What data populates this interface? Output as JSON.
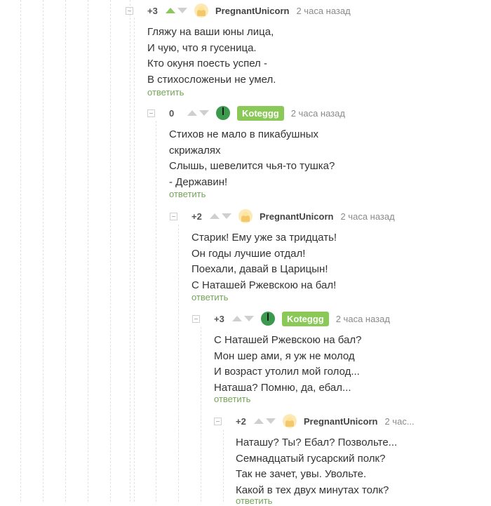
{
  "comments": [
    {
      "rating": "+3",
      "upvoted": true,
      "author": "PregnantUnicorn",
      "avatar": "unicorn-avatar",
      "time": "2 часа назад",
      "lines": [
        "Гляжу на ваши юны лица,",
        "И чую, что я гусеница.",
        "Кто окуня поесть успел -",
        "В стихосложеньи не умел."
      ],
      "reply": "ответить"
    },
    {
      "rating": "0",
      "upvoted": false,
      "author": "Koteggg",
      "avatar": "green-avatar",
      "time": "2 часа назад",
      "lines": [
        "Стихов не мало в пикабушных",
        "скрижалях",
        "Слышь, шевелится чья-то тушка?",
        "- Державин!"
      ],
      "reply": "ответить"
    },
    {
      "rating": "+2",
      "upvoted": false,
      "author": "PregnantUnicorn",
      "avatar": "unicorn-avatar",
      "time": "2 часа назад",
      "lines": [
        "Старик! Ему уже за тридцать!",
        "Он годы лучшие отдал!",
        "Поехали, давай в Царицын!",
        "С Наташей Ржевскою на бал!"
      ],
      "reply": "ответить"
    },
    {
      "rating": "+3",
      "upvoted": false,
      "author": "Koteggg",
      "avatar": "green-avatar",
      "time": "2 часа назад",
      "lines": [
        "С Наташей Ржевскою на бал?",
        "Мон шер ами, я уж не молод",
        "И возраст утолил мой голод...",
        "Наташа? Помню, да, ебал..."
      ],
      "reply": "ответить"
    },
    {
      "rating": "+2",
      "upvoted": false,
      "author": "PregnantUnicorn",
      "avatar": "unicorn-avatar",
      "time": "2 час...",
      "lines": [
        "Наташу? Ты? Ебал? Позвольте...",
        "Семнадцатый гусарский полк?",
        "Так не зачет, увы. Увольте.",
        "Какой в тех двух минутах толк?"
      ],
      "reply": "ответить"
    }
  ],
  "colors": {
    "accent_green": "#8ac858",
    "reply_green": "#73a557"
  }
}
